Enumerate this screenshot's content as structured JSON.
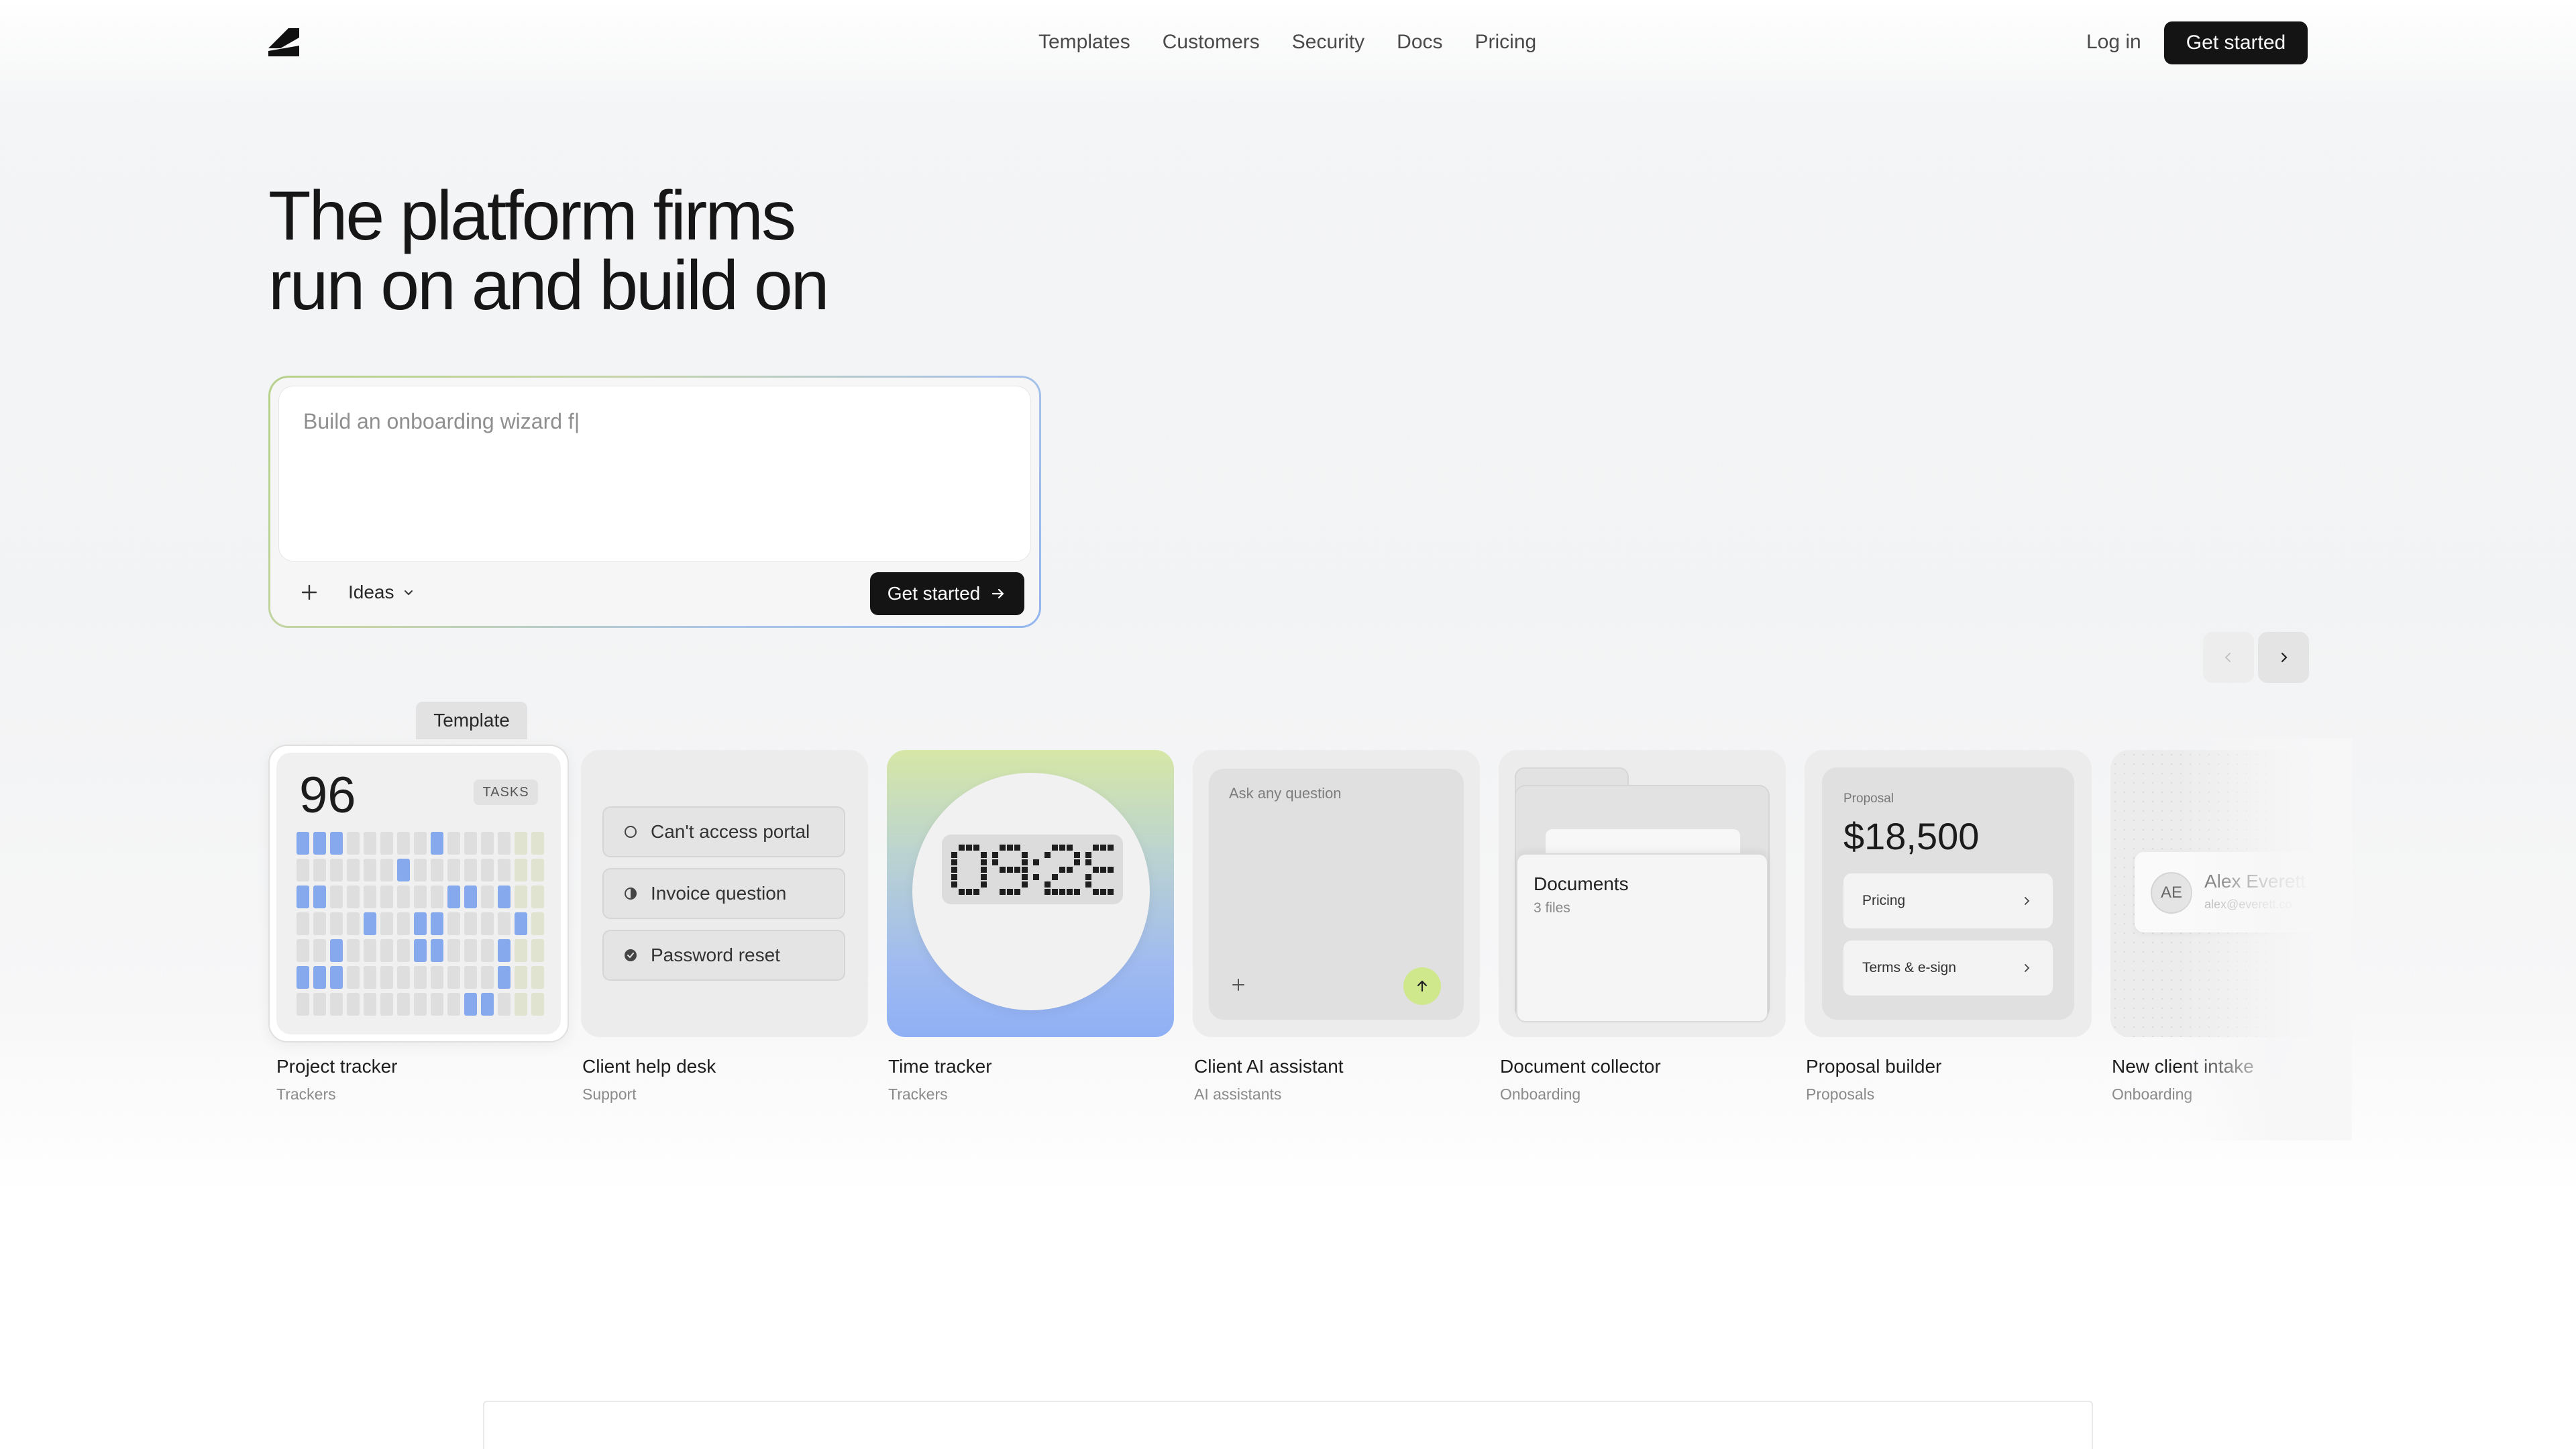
{
  "nav": {
    "logo_icon": "brand-logo-icon",
    "links": [
      "Templates",
      "Customers",
      "Security",
      "Docs",
      "Pricing"
    ],
    "login": "Log in",
    "cta": "Get started"
  },
  "hero": {
    "title_line1": "The platform firms",
    "title_line2": "run on and build on"
  },
  "prompt": {
    "typed_text": "Build an onboarding wizard f|",
    "plus_icon": "plus-icon",
    "ideas_label": "Ideas",
    "cta": "Get started",
    "gradient_colors": [
      "#b7d28c",
      "#93b6ef"
    ]
  },
  "carousel": {
    "prev_icon": "chevron-left-icon",
    "next_icon": "chevron-right-icon",
    "hover_tooltip": "Template"
  },
  "templates": [
    {
      "title": "Project tracker",
      "category": "Trackers",
      "preview": {
        "count": "96",
        "badge": "TASKS"
      }
    },
    {
      "title": "Client help desk",
      "category": "Support",
      "preview": {
        "tickets": [
          "Can't access portal",
          "Invoice question",
          "Password reset"
        ]
      }
    },
    {
      "title": "Time tracker",
      "category": "Trackers",
      "preview": {
        "clock": "09:28"
      }
    },
    {
      "title": "Client AI assistant",
      "category": "AI assistants",
      "preview": {
        "placeholder": "Ask any question"
      }
    },
    {
      "title": "Document collector",
      "category": "Onboarding",
      "preview": {
        "folder": "Documents",
        "files": "3 files"
      }
    },
    {
      "title": "Proposal builder",
      "category": "Proposals",
      "preview": {
        "label": "Proposal",
        "amount": "$18,500",
        "rows": [
          "Pricing",
          "Terms & e-sign"
        ]
      }
    },
    {
      "title": "New client intake",
      "category": "Onboarding",
      "preview": {
        "initials": "AE",
        "name": "Alex Everett",
        "email": "alex@everett.co"
      }
    }
  ],
  "colors": {
    "accent_dark": "#141414",
    "tracker_blue": "#86a9ee",
    "send_green": "#cfe88c"
  }
}
